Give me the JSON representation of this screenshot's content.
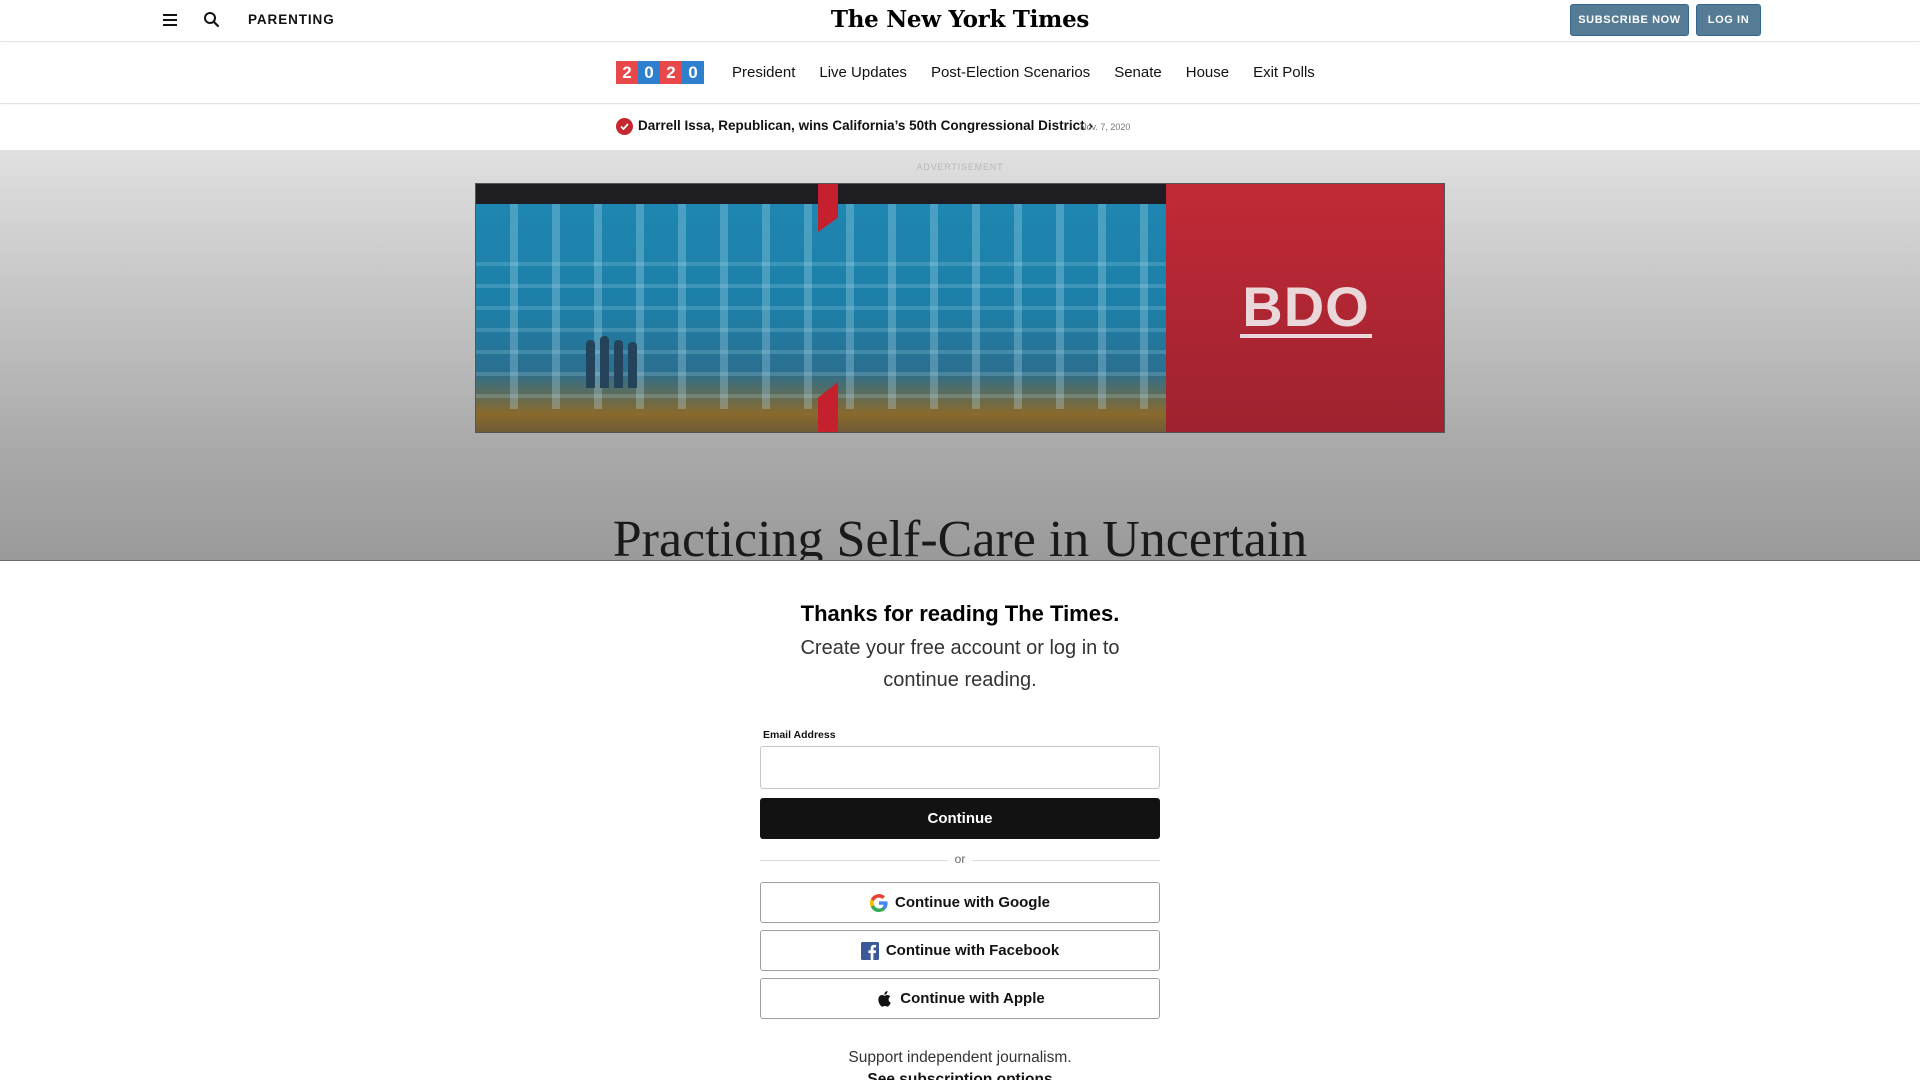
{
  "header": {
    "section": "PARENTING",
    "masthead": "The New York Times",
    "subscribe_label": "SUBSCRIBE NOW",
    "login_label": "LOG IN",
    "menu_icon": "hamburger-menu-icon",
    "search_icon": "search-icon",
    "button_color": "#567b95"
  },
  "election_nav": {
    "logo_digits": [
      {
        "char": "2",
        "color": "#e8484a"
      },
      {
        "char": "0",
        "color": "#2f7fcf"
      },
      {
        "char": "2",
        "color": "#e8484a"
      },
      {
        "char": "0",
        "color": "#2f7fcf"
      }
    ],
    "links": [
      "President",
      "Live Updates",
      "Post-Election Scenarios",
      "Senate",
      "House",
      "Exit Polls"
    ]
  },
  "result_banner": {
    "text": "Darrell Issa, Republican, wins California’s 50th Congressional District ›",
    "date": "Nov. 7, 2020",
    "check_color": "#c5282e"
  },
  "advertisement": {
    "label": "ADVERTISEMENT",
    "brand": "BDO",
    "brand_color": "#c12a36"
  },
  "article": {
    "headline": "Practicing Self-Care in Uncertain"
  },
  "registration": {
    "title": "Thanks for reading The Times.",
    "subtitle": "Create your free account or log in to continue reading.",
    "email_label": "Email Address",
    "email_value": "",
    "continue_label": "Continue",
    "or_text": "or",
    "google_label": "Continue with Google",
    "facebook_label": "Continue with Facebook",
    "apple_label": "Continue with Apple",
    "support_text": "Support independent journalism.",
    "subscription_link": "See subscription options"
  }
}
